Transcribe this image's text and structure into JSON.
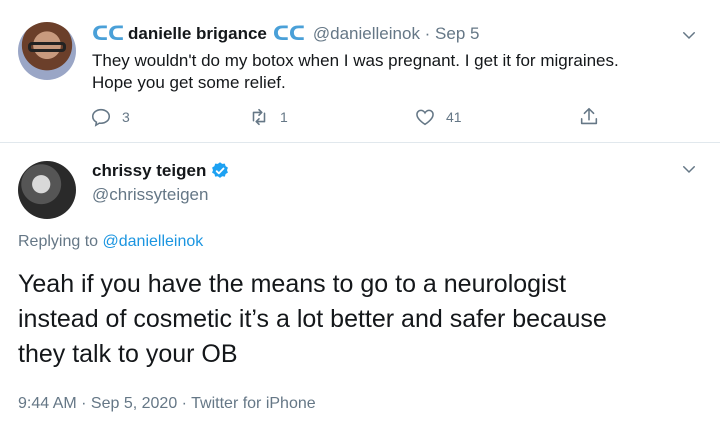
{
  "reply_tweet": {
    "display_name": "danielle brigance",
    "handle": "@danielleinok",
    "time": "Sep 5",
    "handle_time": "@danielleinok · Sep 5",
    "text_line1": "They wouldn't do my botox when I was pregnant.  I get it for migraines.",
    "text_line2": "Hope you get some relief.",
    "reply_count": "3",
    "retweet_count": "1",
    "like_count": "41",
    "name_emoji": "wave-emoji"
  },
  "main_tweet": {
    "display_name": "chrissy teigen",
    "handle": "@chrissyteigen",
    "replying_prefix": "Replying to",
    "replying_mention": "@danielleinok",
    "text_line1": "Yeah if you have the means to go to a neurologist",
    "text_line2": "instead of cosmetic it’s a lot better and safer because",
    "text_line3": "they talk to your OB",
    "timestamp": "9:44 AM · Sep 5, 2020 · Twitter for iPhone"
  },
  "colors": {
    "accent": "#1b95e0",
    "muted": "#657786",
    "text": "#14171a",
    "divider": "#e1e8ed",
    "wave": "#4aa0d8"
  },
  "icons": [
    "reply-icon",
    "retweet-icon",
    "like-icon",
    "share-icon",
    "caret-down-icon",
    "verified-badge-icon",
    "wave-emoji-icon"
  ]
}
